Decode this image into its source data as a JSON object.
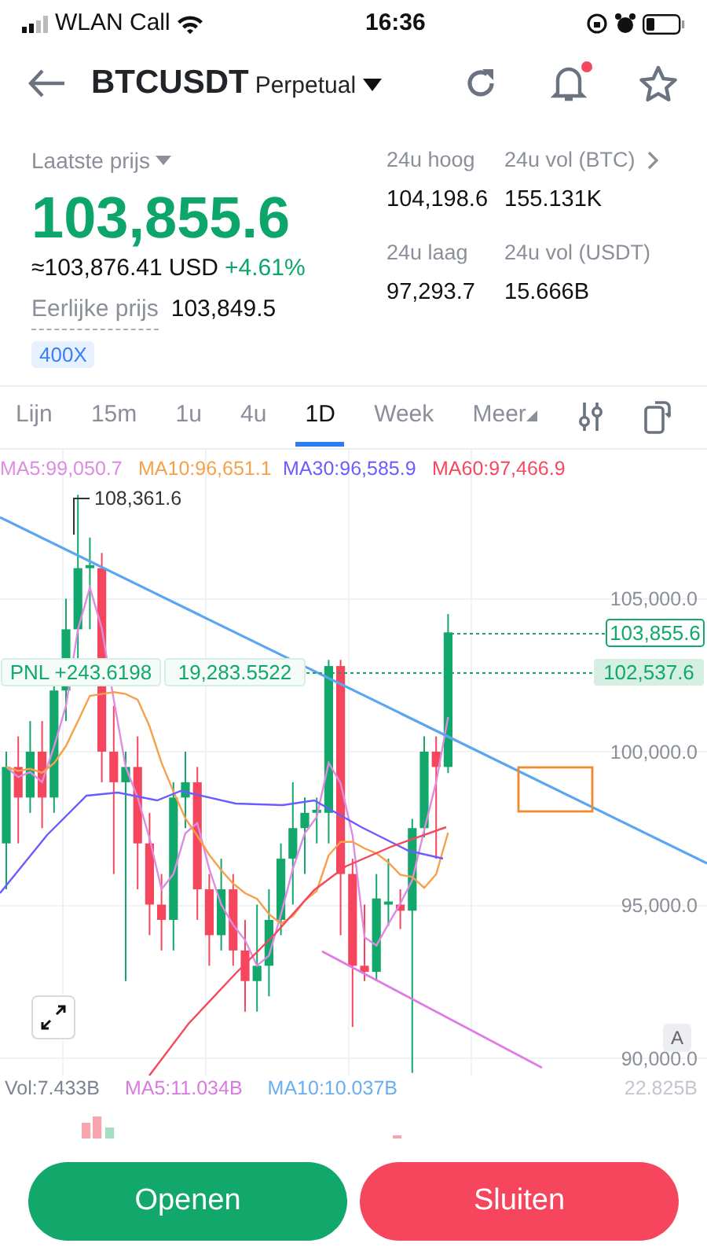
{
  "status_bar": {
    "carrier": "WLAN Call",
    "time": "16:36"
  },
  "header": {
    "symbol": "BTCUSDT",
    "contract": "Perpetual",
    "alert_dot": true
  },
  "ticker": {
    "price_label": "Laatste prijs",
    "price": "103,855.6",
    "approx": "≈103,876.41",
    "currency": "USD",
    "change": "+4.61%",
    "fair_price_label": "Eerlijke prijs",
    "fair_price": "103,849.5",
    "leverage": "400X",
    "stats": [
      {
        "label": "24u hoog",
        "value": "104,198.6"
      },
      {
        "label": "24u vol (BTC)",
        "value": "155.131K",
        "link": true
      },
      {
        "label": "24u laag",
        "value": "97,293.7"
      },
      {
        "label": "24u vol (USDT)",
        "value": "15.666B"
      }
    ]
  },
  "intervals": [
    {
      "label": "Lijn",
      "selected": false,
      "kind": "tab"
    },
    {
      "label": "15m",
      "selected": false,
      "kind": "tab"
    },
    {
      "label": "1u",
      "selected": false,
      "kind": "tab"
    },
    {
      "label": "4u",
      "selected": false,
      "kind": "tab"
    },
    {
      "label": "1D",
      "selected": true,
      "kind": "tab"
    },
    {
      "label": "Week",
      "selected": false,
      "kind": "tab"
    },
    {
      "label": "Meer",
      "selected": false,
      "kind": "dropdown"
    }
  ],
  "chart": {
    "ma_legend": [
      {
        "label": "MA5:99,050.7",
        "color": "#de8be4"
      },
      {
        "label": "MA10:96,651.1",
        "color": "#f7a04b"
      },
      {
        "label": "MA30:96,585.9",
        "color": "#6a5cff"
      },
      {
        "label": "MA60:97,466.9",
        "color": "#f5475d"
      }
    ],
    "high_marker": "108,361.6",
    "y_labels": [
      "105,000.0",
      "100,000.0",
      "95,000.0",
      "90,000.0"
    ],
    "last_price_tag": "103,855.6",
    "entry_price_tag": "102,537.6",
    "position": {
      "pnl": "PNL +243.6198",
      "size": "19,283.5522"
    },
    "autoscale": "A"
  },
  "volume": {
    "legend": [
      {
        "label": "Vol:7.433B",
        "color": "#7b8390"
      },
      {
        "label": "MA5:11.034B",
        "color": "#d77be0"
      },
      {
        "label": "MA10:10.037B",
        "color": "#6aaef0"
      }
    ],
    "max_label": "22.825B"
  },
  "actions": [
    {
      "label": "Openen",
      "kind": "buy"
    },
    {
      "label": "Sluiten",
      "kind": "sell"
    }
  ]
}
